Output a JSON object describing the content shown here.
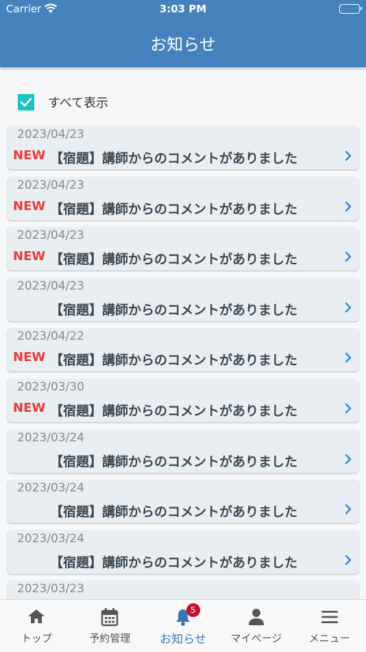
{
  "status_bar": {
    "carrier": "Carrier",
    "time": "3:03 PM"
  },
  "header": {
    "title": "お知らせ"
  },
  "filter": {
    "label": "すべて表示",
    "checked": true
  },
  "notifications": [
    {
      "date": "2023/04/23",
      "new": "NEW",
      "title": "【宿題】講師からのコメントがありました"
    },
    {
      "date": "2023/04/23",
      "new": "NEW",
      "title": "【宿題】講師からのコメントがありました"
    },
    {
      "date": "2023/04/23",
      "new": "NEW",
      "title": "【宿題】講師からのコメントがありました"
    },
    {
      "date": "2023/04/23",
      "new": "",
      "title": "【宿題】講師からのコメントがありました"
    },
    {
      "date": "2023/04/22",
      "new": "NEW",
      "title": "【宿題】講師からのコメントがありました"
    },
    {
      "date": "2023/03/30",
      "new": "NEW",
      "title": "【宿題】講師からのコメントがありました"
    },
    {
      "date": "2023/03/24",
      "new": "",
      "title": "【宿題】講師からのコメントがありました"
    },
    {
      "date": "2023/03/24",
      "new": "",
      "title": "【宿題】講師からのコメントがありました"
    },
    {
      "date": "2023/03/24",
      "new": "",
      "title": "【宿題】講師からのコメントがありました"
    },
    {
      "date": "2023/03/23",
      "new": "",
      "title": ""
    }
  ],
  "tabbar": {
    "items": [
      {
        "label": "トップ",
        "icon": "home-icon"
      },
      {
        "label": "予約管理",
        "icon": "calendar-icon"
      },
      {
        "label": "お知らせ",
        "icon": "bell-icon",
        "badge": "5"
      },
      {
        "label": "マイページ",
        "icon": "person-icon"
      },
      {
        "label": "メニュー",
        "icon": "menu-icon"
      }
    ]
  },
  "colors": {
    "header": "#4582bd",
    "accent": "#3b77b8",
    "new": "#ec3a35",
    "checkbox": "#19c3c6",
    "badge": "#c8102e"
  }
}
